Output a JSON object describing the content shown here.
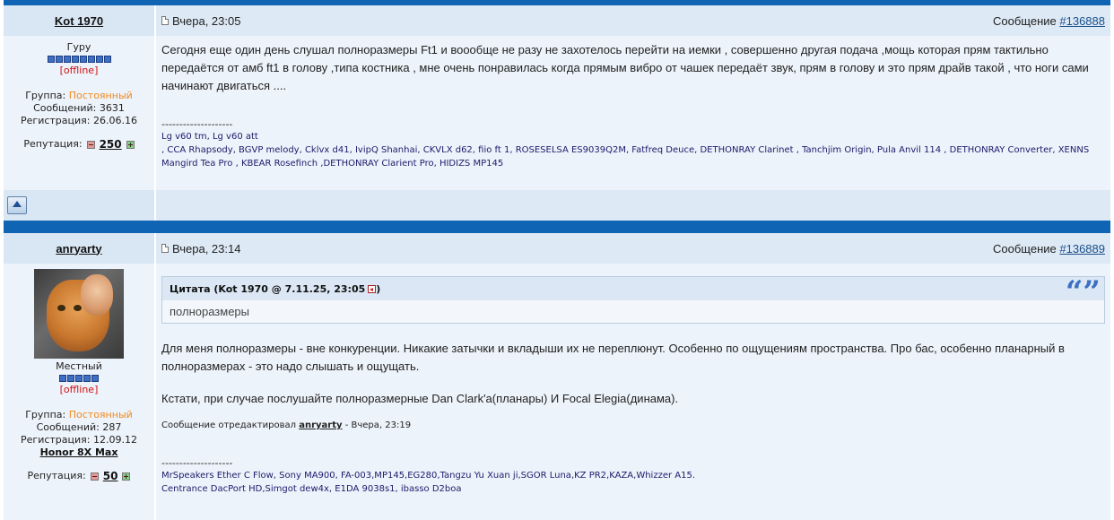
{
  "posts": [
    {
      "author": "Kot 1970",
      "date": "Вчера, 23:05",
      "message_label": "Сообщение ",
      "message_id": "#136888",
      "rank": "Гуру",
      "rank_pips": 8,
      "status": "[offline]",
      "group_label": "Группа: ",
      "group_value": "Постоянный",
      "posts_count": "Сообщений: 3631",
      "registered": "Регистрация: 26.06.16",
      "reputation_label": "Репутация:",
      "reputation_value": "250",
      "text": "Сегодня еще один день слушал полноразмеры Ft1 и воообще не разу не захотелось перейти на иемки , совершенно другая подача ,мощь которая прям тактильно передаётся от амб ft1 в голову ,типа костника , мне очень понравилась когда прямым вибро от чашек передаёт звук, прям в голову и это прям драйв такой , что ноги сами начинают двигаться ....",
      "signature_dash": "--------------------",
      "signature_lines": [
        "Lg v60 tm, Lg v60 att",
        ", CCA Rhapsody, BGVP melody, Cklvx d41, IvipQ Shanhai, CKVLX d62, fiio ft 1, ROSESELSA ES9039Q2M, Fatfreq Deuce, DETHONRAY Clarinet , Tanchjim Origin, Pula Anvil 114 , DETHONRAY Converter, XENNS Mangird Tea Pro , KBEAR Rosefinch ,DETHONRAY Clarient Pro, HIDIZS MP145"
      ]
    },
    {
      "author": "anryarty",
      "date": "Вчера, 23:14",
      "message_label": "Сообщение ",
      "message_id": "#136889",
      "rank": "Местный",
      "rank_pips": 5,
      "status": "[offline]",
      "group_label": "Группа: ",
      "group_value": "Постоянный",
      "posts_count": "Сообщений: 287",
      "registered": "Регистрация: 12.09.12",
      "device": "Honor 8X Max",
      "reputation_label": "Репутация:",
      "reputation_value": "50",
      "quote_header": "Цитата (Kot 1970 @ 7.11.25, 23:05",
      "quote_header_close": ")",
      "quote_mark": "“”",
      "quote_text": "полноразмеры",
      "text_1": "Для меня полноразмеры - вне конкуренции. Никакие затычки и вкладыши их не переплюнут. Особенно по ощущениям пространства. Про бас, особенно планарный в полноразмерах - это надо слышать и ощущать.",
      "text_2": "Кстати, при случае послушайте полноразмерные Dan Clark'a(планары) И Focal Elegia(динама).",
      "edited_prefix": "Сообщение отредактировал ",
      "edited_by": "anryarty",
      "edited_suffix": " - Вчера, 23:19",
      "signature_dash": "--------------------",
      "signature_lines": [
        "MrSpeakers Ether C Flow, Sony MA900, FA-003,MP145,EG280,Tangzu Yu Xuan ji,SGOR Luna,KZ PR2,KAZA,Whizzer A15.",
        "Centrance DacPort HD,Simgot dew4x, E1DA 9038s1, ibasso D2boa"
      ]
    }
  ],
  "colors": {
    "bar": "#0f64b3",
    "header_bg": "#dde9f5",
    "body_bg": "#edf3fa",
    "offline": "#d01010",
    "group": "#f08a1c",
    "quote_mark": "#3b6fc4"
  }
}
